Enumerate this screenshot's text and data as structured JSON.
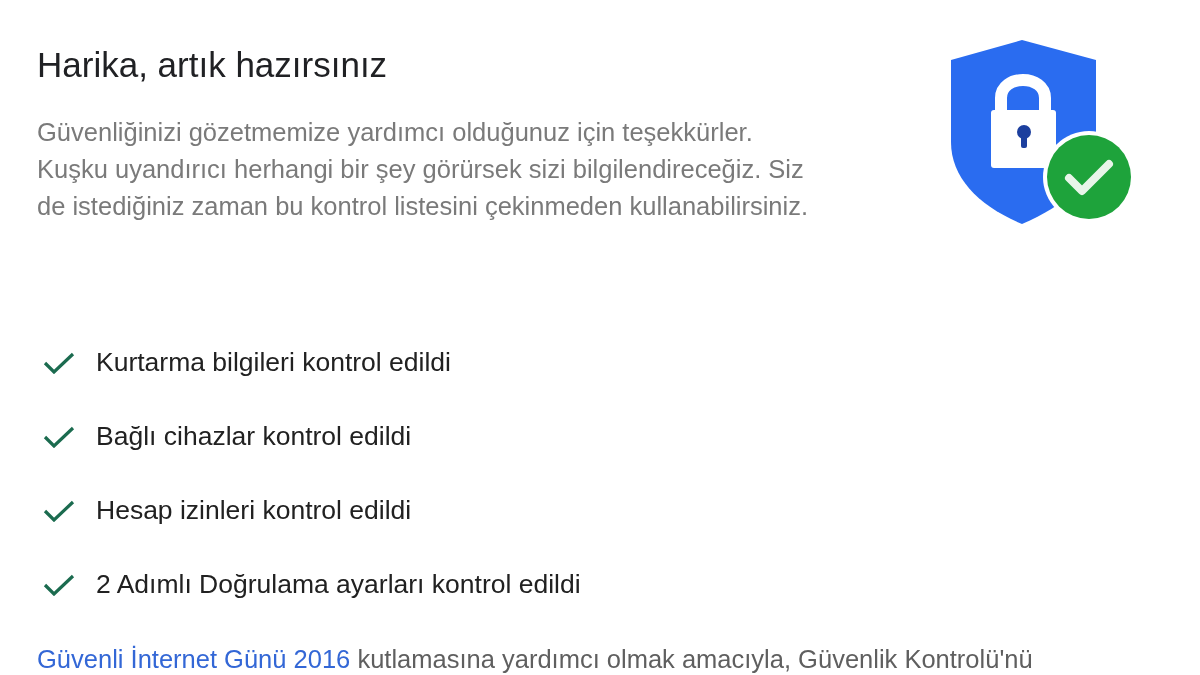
{
  "title": "Harika, artık hazırsınız",
  "description": "Güvenliğinizi gözetmemize yardımcı olduğunuz için teşekkürler.\nKuşku uyandırıcı herhangi bir şey görürsek sizi bilgilendireceğiz. Siz de istediğiniz zaman bu kontrol listesini çekinmeden kullanabilirsiniz.",
  "checklist": [
    {
      "label": "Kurtarma bilgileri kontrol edildi",
      "checked": true
    },
    {
      "label": "Bağlı cihazlar kontrol edildi",
      "checked": true
    },
    {
      "label": "Hesap izinleri kontrol edildi",
      "checked": true
    },
    {
      "label": "2 Adımlı Doğrulama ayarları kontrol edildi",
      "checked": true
    }
  ],
  "footer": {
    "link": "Güvenli İnternet Günü 2016",
    "text": "kutlamasına yardımcı olmak amacıyla, Güvenlik Kontrolü'nü"
  }
}
